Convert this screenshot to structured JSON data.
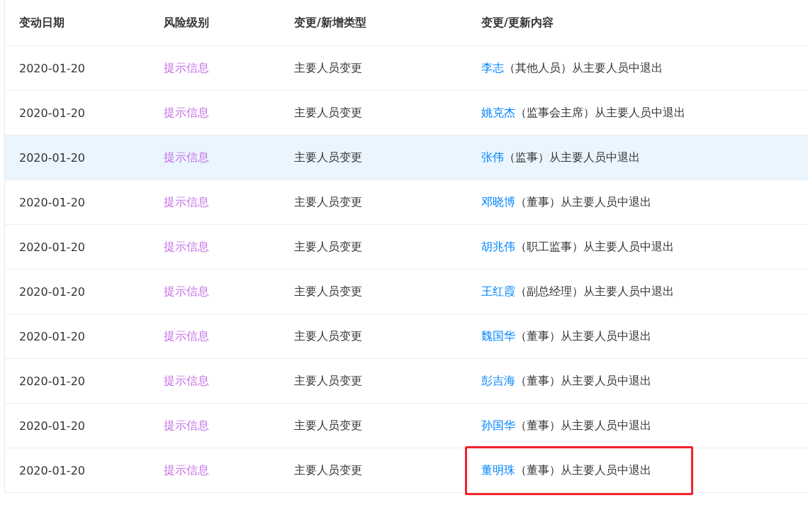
{
  "table": {
    "columns": [
      "变动日期",
      "风险级别",
      "变更/新增类型",
      "变更/更新内容"
    ],
    "rows": [
      {
        "date": "2020-01-20",
        "risk": "提示信息",
        "type": "主要人员变更",
        "person": "李志",
        "detail": "（其他人员）从主要人员中退出",
        "hovered": false,
        "marked": false
      },
      {
        "date": "2020-01-20",
        "risk": "提示信息",
        "type": "主要人员变更",
        "person": "姚克杰",
        "detail": "（监事会主席）从主要人员中退出",
        "hovered": false,
        "marked": false
      },
      {
        "date": "2020-01-20",
        "risk": "提示信息",
        "type": "主要人员变更",
        "person": "张伟",
        "detail": "（监事）从主要人员中退出",
        "hovered": true,
        "marked": false
      },
      {
        "date": "2020-01-20",
        "risk": "提示信息",
        "type": "主要人员变更",
        "person": "邓晓博",
        "detail": "（董事）从主要人员中退出",
        "hovered": false,
        "marked": false
      },
      {
        "date": "2020-01-20",
        "risk": "提示信息",
        "type": "主要人员变更",
        "person": "胡兆伟",
        "detail": "（职工监事）从主要人员中退出",
        "hovered": false,
        "marked": false
      },
      {
        "date": "2020-01-20",
        "risk": "提示信息",
        "type": "主要人员变更",
        "person": "王红霞",
        "detail": "（副总经理）从主要人员中退出",
        "hovered": false,
        "marked": false
      },
      {
        "date": "2020-01-20",
        "risk": "提示信息",
        "type": "主要人员变更",
        "person": "魏国华",
        "detail": "（董事）从主要人员中退出",
        "hovered": false,
        "marked": false
      },
      {
        "date": "2020-01-20",
        "risk": "提示信息",
        "type": "主要人员变更",
        "person": "彭吉海",
        "detail": "（董事）从主要人员中退出",
        "hovered": false,
        "marked": false
      },
      {
        "date": "2020-01-20",
        "risk": "提示信息",
        "type": "主要人员变更",
        "person": "孙国华",
        "detail": "（董事）从主要人员中退出",
        "hovered": false,
        "marked": false
      },
      {
        "date": "2020-01-20",
        "risk": "提示信息",
        "type": "主要人员变更",
        "person": "董明珠",
        "detail": "（董事）从主要人员中退出",
        "hovered": false,
        "marked": true
      }
    ]
  }
}
